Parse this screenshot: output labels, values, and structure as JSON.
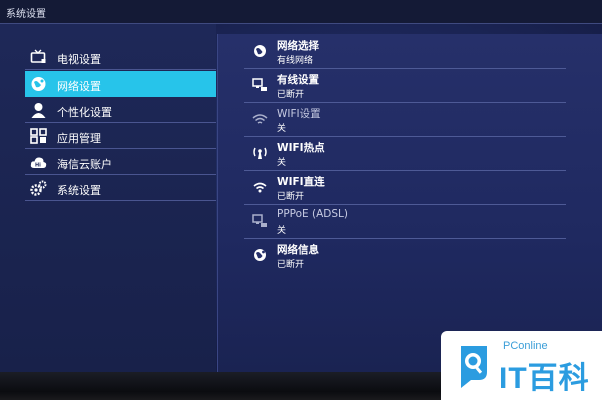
{
  "window": {
    "title": "系统设置"
  },
  "sidebar": {
    "items": [
      {
        "label": "电视设置",
        "icon": "tv-icon",
        "active": false
      },
      {
        "label": "网络设置",
        "icon": "globe-icon",
        "active": true
      },
      {
        "label": "个性化设置",
        "icon": "person-icon",
        "active": false
      },
      {
        "label": "应用管理",
        "icon": "apps-grid-icon",
        "active": false
      },
      {
        "label": "海信云账户",
        "icon": "cloud-icon",
        "active": false
      },
      {
        "label": "系统设置",
        "icon": "gear-icon",
        "active": false
      }
    ]
  },
  "network": {
    "items": [
      {
        "title": "网络选择",
        "value": "有线网络",
        "icon": "globe-icon",
        "enabled": true
      },
      {
        "title": "有线设置",
        "value": "已断开",
        "icon": "monitor-icon",
        "enabled": true
      },
      {
        "title": "WIFI设置",
        "value": "关",
        "icon": "wifi-icon",
        "enabled": false
      },
      {
        "title": "WIFI热点",
        "value": "关",
        "icon": "hotspot-icon",
        "enabled": true
      },
      {
        "title": "WIFI直连",
        "value": "已断开",
        "icon": "wifi-direct-icon",
        "enabled": true
      },
      {
        "title": "PPPoE (ADSL)",
        "value": "关",
        "icon": "pppoe-icon",
        "enabled": false
      },
      {
        "title": "网络信息",
        "value": "已断开",
        "icon": "info-globe-icon",
        "enabled": true
      }
    ]
  },
  "watermark": {
    "brand_small": "PConline",
    "brand_big": "IT百科"
  },
  "colors": {
    "accent": "#27c4ea",
    "background": "#1f2960",
    "text": "#ffffff"
  }
}
